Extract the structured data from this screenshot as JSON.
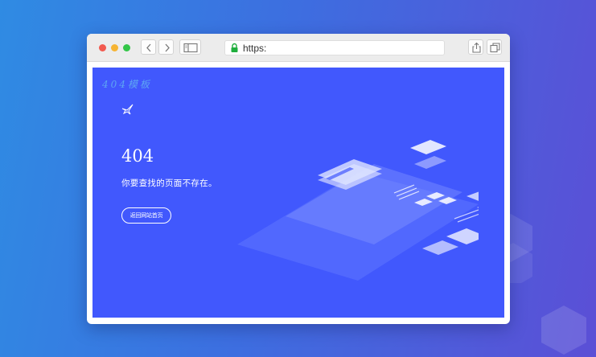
{
  "browser": {
    "address_bar": {
      "url": "https:"
    },
    "icons": [
      "close-dot",
      "minimize-dot",
      "zoom-dot",
      "chevron-left-icon",
      "chevron-right-icon",
      "sidebar-icon",
      "lock-icon",
      "share-icon",
      "tabs-icon"
    ]
  },
  "page": {
    "template_label": "404模板",
    "error_code": "404",
    "message": "你要查找的页面不存在。",
    "home_button_label": "返回网站首页"
  },
  "colors": {
    "page_background": "#4158fd",
    "outer_gradient_start": "#2f8be3",
    "outer_gradient_end": "#5b4fd6",
    "template_label": "#5da4f3",
    "lock": "#1fae3d"
  }
}
